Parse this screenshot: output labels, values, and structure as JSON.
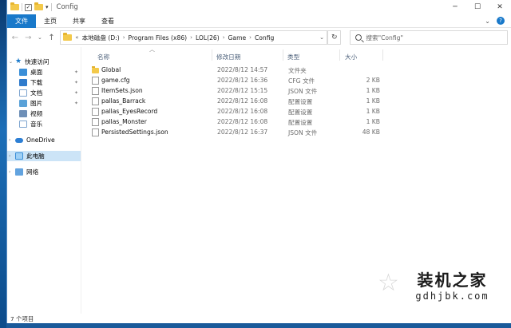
{
  "window": {
    "title": "Config"
  },
  "ribbon": {
    "tabs": [
      "文件",
      "主页",
      "共享",
      "查看"
    ]
  },
  "address": {
    "crumbs": [
      "本地磁盘 (D:)",
      "Program Files (x86)",
      "LOL(26)",
      "Game",
      "Config"
    ],
    "prefix": "«"
  },
  "search": {
    "placeholder": "搜索\"Config\""
  },
  "sidebar": {
    "quick_access": "快速访问",
    "items": [
      "桌面",
      "下载",
      "文档",
      "图片",
      "视频",
      "音乐"
    ],
    "onedrive": "OneDrive",
    "this_pc": "此电脑",
    "network": "网络"
  },
  "columns": {
    "name": "名称",
    "date": "修改日期",
    "type": "类型",
    "size": "大小"
  },
  "files": [
    {
      "name": "Global",
      "date": "2022/8/12 14:57",
      "type": "文件夹",
      "size": "",
      "icon": "folder"
    },
    {
      "name": "game.cfg",
      "date": "2022/8/12 16:36",
      "type": "CFG 文件",
      "size": "2 KB",
      "icon": "file"
    },
    {
      "name": "ItemSets.json",
      "date": "2022/8/12 15:15",
      "type": "JSON 文件",
      "size": "1 KB",
      "icon": "file"
    },
    {
      "name": "pallas_Barrack",
      "date": "2022/8/12 16:08",
      "type": "配置设置",
      "size": "1 KB",
      "icon": "file"
    },
    {
      "name": "pallas_EyesRecord",
      "date": "2022/8/12 16:08",
      "type": "配置设置",
      "size": "1 KB",
      "icon": "file"
    },
    {
      "name": "pallas_Monster",
      "date": "2022/8/12 16:08",
      "type": "配置设置",
      "size": "1 KB",
      "icon": "file"
    },
    {
      "name": "PersistedSettings.json",
      "date": "2022/8/12 16:37",
      "type": "JSON 文件",
      "size": "48 KB",
      "icon": "file"
    }
  ],
  "status": {
    "count": "7 个项目"
  },
  "watermark": {
    "cn": "装机之家",
    "url": "gdhjbk.com"
  }
}
